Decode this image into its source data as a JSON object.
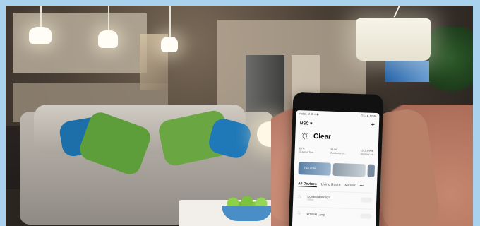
{
  "phone": {
    "status_left": "Vodaf. ul ☰ ⌂ ◉",
    "status_right": "⊡ ⊿ ▮ 12:46",
    "home_name": "NSC ▾",
    "add_button": "+",
    "weather_icon": "sun-icon",
    "weather_condition": "Clear",
    "stats": [
      {
        "value": "24°C",
        "label": "Outdoor Tem..."
      },
      {
        "value": "38.0%",
        "label": "Outdoor Hu..."
      },
      {
        "value": "1013.9hPa",
        "label": "Outdoor Air..."
      }
    ],
    "scenes": [
      {
        "label": "Den 80%"
      },
      {
        "label": ""
      }
    ],
    "tabs": [
      "All Devices",
      "Living Room",
      "Master"
    ],
    "more_tabs": "•••",
    "devices": [
      {
        "name": "KOBEM downlight",
        "sub": "Offline"
      },
      {
        "name": "KOBEM Lamp",
        "sub": ""
      }
    ]
  }
}
